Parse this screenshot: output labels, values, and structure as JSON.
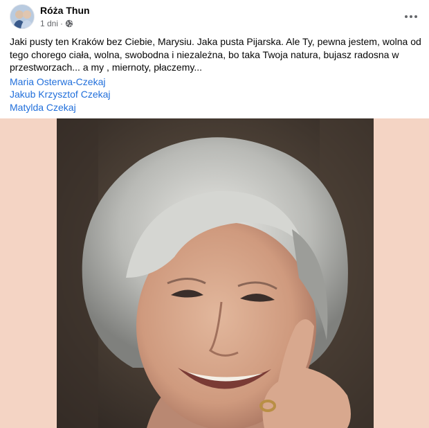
{
  "post": {
    "author": "Róża Thun",
    "time": "1 dni",
    "separator": "·",
    "text": "Jaki pusty ten Kraków bez Ciebie, Marysiu. Jaka pusta Pijarska. Ale Ty, pewna jestem, wolna od tego chorego ciała, wolna, swobodna i niezależna, bo taka Twoja natura, bujasz radosna w przestworzach... a my , miernoty, płaczemy...",
    "tags": [
      "Maria Osterwa-Czekaj",
      "Jakub Krzysztof Czekaj",
      "Matylda Czekaj"
    ]
  },
  "icons": {
    "privacy": "globe-icon",
    "menu": "more-options-icon"
  },
  "colors": {
    "link": "#216fdb",
    "secondary_text": "#65676b",
    "media_background": "#f4d4c4"
  }
}
